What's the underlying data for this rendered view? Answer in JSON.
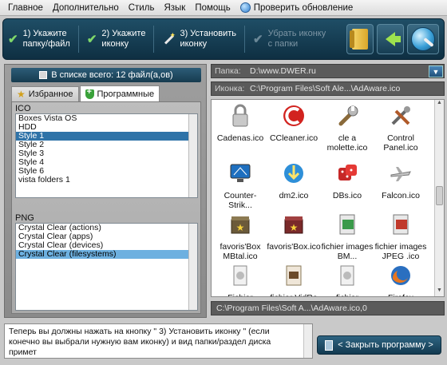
{
  "menu": [
    "Главное",
    "Дополнительно",
    "Стиль",
    "Язык",
    "Помощь",
    "Проверить обновление"
  ],
  "toolbar": {
    "steps": [
      {
        "label": "1) Укажите\nпапку/файл",
        "enabled": true
      },
      {
        "label": "2) Укажите\nиконку",
        "enabled": true
      },
      {
        "label": "3) Установить\nиконку",
        "enabled": true
      },
      {
        "label": "Убрать иконку\nс папки",
        "enabled": false
      }
    ],
    "buttons": [
      "folder-icon",
      "back-arrow-icon",
      "globe-search-icon"
    ]
  },
  "left": {
    "count_text": "В списке всего: 12 файл(а,ов)",
    "tabs": [
      "Избранное",
      "Программные"
    ],
    "active_tab": "Программные",
    "ico_label": "ICO",
    "ico_items": [
      "Boxes Vista OS",
      "HDD",
      "Style 1",
      "Style 2",
      "Style 3",
      "Style 4",
      "Style 6",
      "vista folders 1"
    ],
    "ico_selected": "Style 1",
    "png_label": "PNG",
    "png_items": [
      "Crystal Clear (actions)",
      "Crystal Clear (apps)",
      "Crystal Clear (devices)",
      "Crystal Clear (filesystems)"
    ],
    "png_selected": "Crystal Clear (filesystems)"
  },
  "right": {
    "folder_label": "Папка:",
    "folder_value": "D:\\www.DWER.ru",
    "icon_label": "Иконка:",
    "icon_value": "C:\\Program Files\\Soft Ale...\\AdAware.ico",
    "icons": [
      {
        "name": "Cadenas.ico",
        "icon": "padlock-icon"
      },
      {
        "name": "CCleaner.ico",
        "icon": "ccleaner-icon"
      },
      {
        "name": "cle a molette.ico",
        "icon": "wrench-icon"
      },
      {
        "name": "Control Panel.ico",
        "icon": "tools-icon"
      },
      {
        "name": "Counter-Strik...",
        "icon": "monitor-icon"
      },
      {
        "name": "dm2.ico",
        "icon": "download-globe-icon"
      },
      {
        "name": "DBs.ico",
        "icon": "dice-icon"
      },
      {
        "name": "Falcon.ico",
        "icon": "plane-icon"
      },
      {
        "name": "favoris'Box MBtal.ico",
        "icon": "box-star-icon"
      },
      {
        "name": "favoris'Box.ico",
        "icon": "box-star-red-icon"
      },
      {
        "name": "fichier images BM...",
        "icon": "image-file-green-icon"
      },
      {
        "name": "fichier images JPEG .ico",
        "icon": "image-file-red-icon"
      },
      {
        "name": "Fichier",
        "icon": "document-icon"
      },
      {
        "name": "fichier VidRo",
        "icon": "video-file-icon"
      },
      {
        "name": "fichier",
        "icon": "document-icon"
      },
      {
        "name": "Firefox",
        "icon": "firefox-icon"
      }
    ],
    "status_path": "C:\\Program Files\\Soft A...\\AdAware.ico,0"
  },
  "hint": "Теперь вы должны нажать на кнопку \" 3)  Установить иконку \" (если конечно вы выбрали нужную вам иконку) и вид папки/раздел диска примет",
  "close_button": "< Закрыть программу >"
}
